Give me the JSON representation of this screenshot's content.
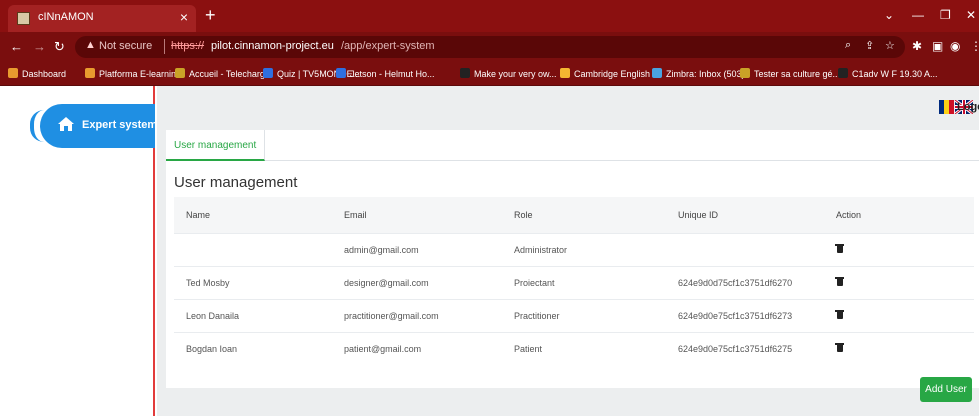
{
  "browser": {
    "tab_title": "cINnAMON",
    "tab_close": "×",
    "new_tab": "+",
    "window_controls": {
      "dropdown": "⌄",
      "minimize": "—",
      "restore": "❐",
      "close": "✕"
    },
    "address": {
      "warning": "▲",
      "not_secure": "Not secure",
      "url_scheme": "https://",
      "url_host": "pilot.cinnamon-project.eu",
      "url_path": "/app/expert-system"
    },
    "bookmarks": [
      {
        "label": "Dashboard",
        "color": "#e89b2f"
      },
      {
        "label": "Platforma E-learnin...",
        "color": "#e89b2f"
      },
      {
        "label": "Accueil - Telecharg...",
        "color": "#c9a227"
      },
      {
        "label": "Quiz | TV5MONDE...",
        "color": "#2f6fe0"
      },
      {
        "label": "Jetson - Helmut Ho...",
        "color": "#2f6fe0"
      },
      {
        "label": "Make your very ow...",
        "color": "#222222"
      },
      {
        "label": "Cambridge English",
        "color": "#f5b731"
      },
      {
        "label": "Zimbra: Inbox (503)",
        "color": "#4aa3df"
      },
      {
        "label": "Tester sa culture gé...",
        "color": "#c9a227"
      },
      {
        "label": "C1adv W F 19.30 A...",
        "color": "#222222"
      }
    ]
  },
  "sidebar": {
    "item_label": "Expert system",
    "icon": "home-icon"
  },
  "header": {
    "logout_label": "Logout",
    "flags": [
      "ro-flag",
      "uk-flag"
    ]
  },
  "main": {
    "tab_label": "User management",
    "section_title": "User management",
    "columns": [
      "Name",
      "Email",
      "Role",
      "Unique ID",
      "Action"
    ],
    "rows": [
      {
        "name": "",
        "email": "admin@gmail.com",
        "role": "Administrator",
        "uid": ""
      },
      {
        "name": "Ted Mosby",
        "email": "designer@gmail.com",
        "role": "Proiectant",
        "uid": "624e9d0d75cf1c3751df6270"
      },
      {
        "name": "Leon Danaila",
        "email": "practitioner@gmail.com",
        "role": "Practitioner",
        "uid": "624e9d0e75cf1c3751df6273"
      },
      {
        "name": "Bogdan Ioan",
        "email": "patient@gmail.com",
        "role": "Patient",
        "uid": "624e9d0e75cf1c3751df6275"
      }
    ],
    "add_user_label": "Add User"
  },
  "colors": {
    "chrome": "#8b1010",
    "accent_blue": "#1f8fe3",
    "accent_green": "#28a745",
    "sidebar_border": "#e23b3b"
  }
}
